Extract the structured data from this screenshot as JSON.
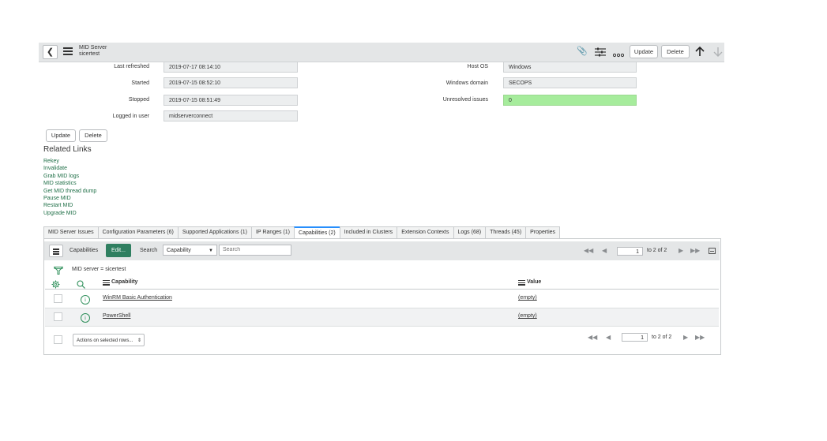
{
  "header": {
    "title_line1": "MID Server",
    "title_line2": "sicertest",
    "back_icon": "chevron-left-icon",
    "menu_icon": "hamburger-menu-icon",
    "attachment_icon": "paperclip-icon",
    "settings_icon": "sliders-icon",
    "more_icon": "more-options-icon",
    "update_label": "Update",
    "delete_label": "Delete",
    "up_icon": "arrow-up-icon",
    "down_icon": "arrow-down-icon"
  },
  "form": {
    "left": [
      {
        "label": "Last refreshed",
        "value": "2019-07-17 08:14:10"
      },
      {
        "label": "Started",
        "value": "2019-07-15 08:52:10"
      },
      {
        "label": "Stopped",
        "value": "2019-07-15 08:51:49"
      },
      {
        "label": "Logged in user",
        "value": "midserverconnect"
      }
    ],
    "right": [
      {
        "label": "Host OS",
        "value": "Windows"
      },
      {
        "label": "Windows domain",
        "value": "SECOPS"
      },
      {
        "label": "Unresolved issues",
        "value": "0"
      }
    ],
    "update_label": "Update",
    "delete_label": "Delete"
  },
  "related_links": {
    "title": "Related Links",
    "items": [
      "Rekey",
      "Invalidate",
      "Grab MID logs",
      "MID statistics",
      "Get MID thread dump",
      "Pause MID",
      "Restart MID",
      "Upgrade MID"
    ]
  },
  "tabs": [
    "MID Server Issues",
    "Configuration Parameters (6)",
    "Supported Applications (1)",
    "IP Ranges (1)",
    "Capabilities (2)",
    "Included in Clusters",
    "Extension Contexts",
    "Logs (68)",
    "Threads (45)",
    "Properties"
  ],
  "active_tab": "Capabilities (2)",
  "list": {
    "title": "Capabilities",
    "edit_label": "Edit...",
    "search_label": "Search",
    "search_field": "Capability",
    "search_placeholder": "Search",
    "filter_text": "MID server = sicertest",
    "col_capability": "Capability",
    "col_value": "Value",
    "rows": [
      {
        "capability": "WinRM Basic Authentication",
        "value": "(empty)"
      },
      {
        "capability": "PowerShell",
        "value": "(empty)"
      }
    ],
    "actions_label": "Actions on selected rows...",
    "page_value": "1",
    "page_total": "to 2 of 2"
  },
  "colors": {
    "accent_green": "#2f7f60",
    "highlight_green": "#a6ec9c",
    "link_green": "#1f6f47",
    "header_bg": "#e4e6e7"
  }
}
